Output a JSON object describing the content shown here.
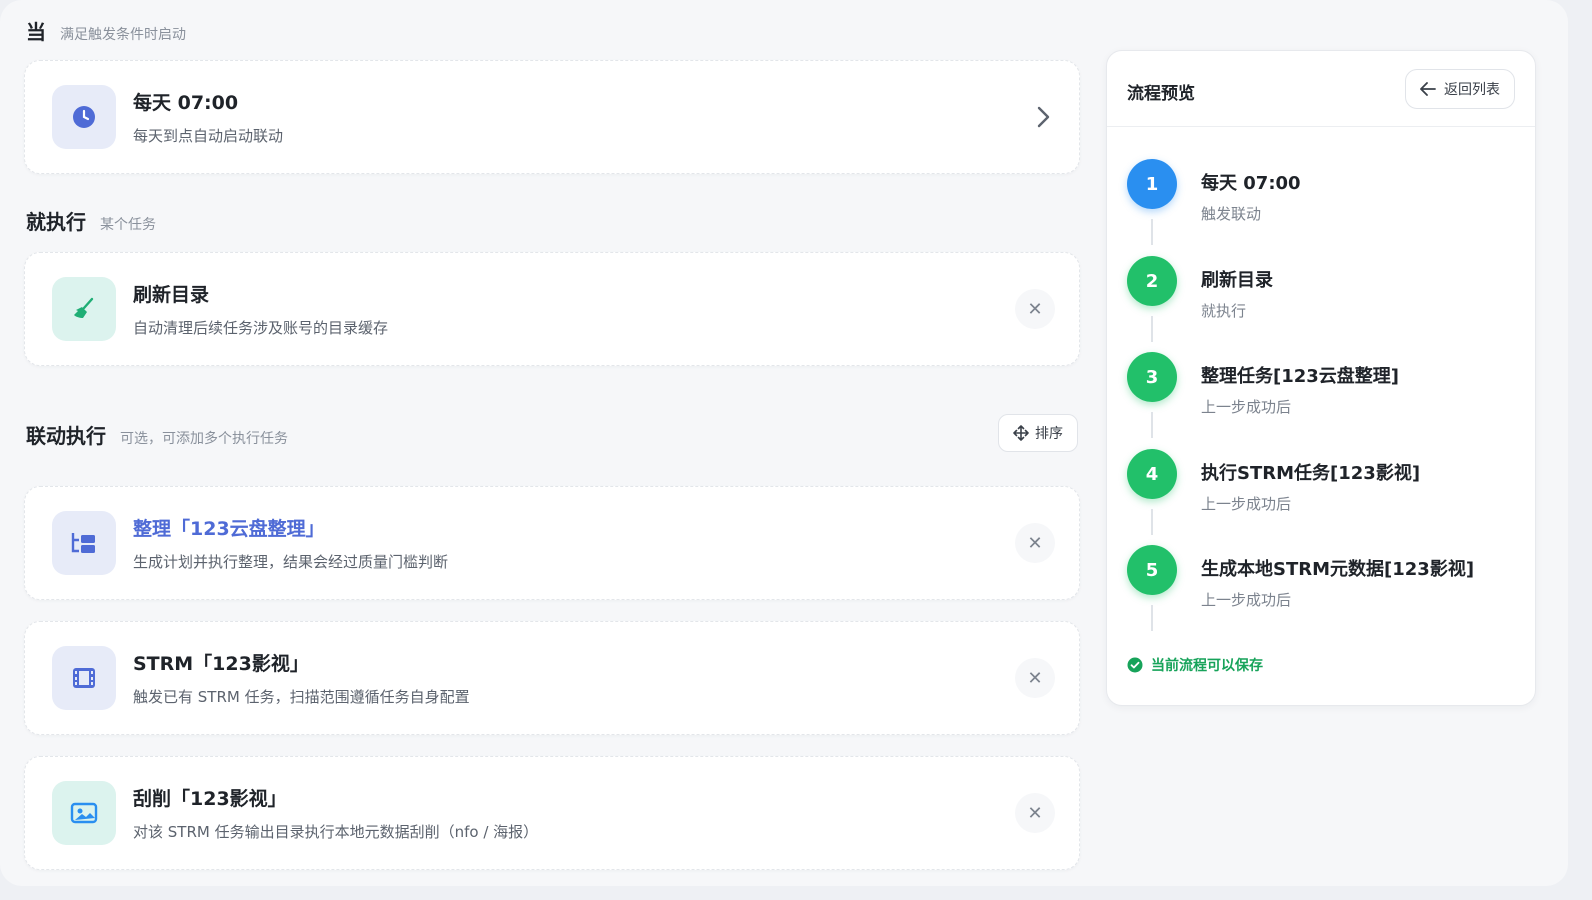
{
  "when": {
    "title": "当",
    "subtitle": "满足触发条件时启动"
  },
  "trigger": {
    "title": "每天 07:00",
    "desc": "每天到点自动启动联动",
    "icon": "clock-icon"
  },
  "then": {
    "title": "就执行",
    "subtitle": "某个任务"
  },
  "main_task": {
    "title": "刷新目录",
    "desc": "自动清理后续任务涉及账号的目录缓存",
    "icon": "broom-icon"
  },
  "linked": {
    "title": "联动执行",
    "subtitle": "可选，可添加多个执行任务",
    "sort_label": "排序"
  },
  "linked_tasks": [
    {
      "title": "整理「123云盘整理」",
      "desc": "生成计划并执行整理，结果会经过质量门槛判断",
      "icon": "folder-tree-icon"
    },
    {
      "title": "STRM「123影视」",
      "desc": "触发已有 STRM 任务，扫描范围遵循任务自身配置",
      "icon": "film-icon"
    },
    {
      "title": "刮削「123影视」",
      "desc": "对该 STRM 任务输出目录执行本地元数据刮削（nfo / 海报）",
      "icon": "image-icon"
    }
  ],
  "preview": {
    "title": "流程预览",
    "back_label": "返回列表",
    "steps": [
      {
        "num": "1",
        "title": "每天 07:00",
        "sub": "触发联动",
        "color": "#2a8ff0"
      },
      {
        "num": "2",
        "title": "刷新目录",
        "sub": "就执行",
        "color": "#22c06a"
      },
      {
        "num": "3",
        "title": "整理任务[123云盘整理]",
        "sub": "上一步成功后",
        "color": "#22c06a"
      },
      {
        "num": "4",
        "title": "执行STRM任务[123影视]",
        "sub": "上一步成功后",
        "color": "#22c06a"
      },
      {
        "num": "5",
        "title": "生成本地STRM元数据[123影视]",
        "sub": "上一步成功后",
        "color": "#22c06a"
      }
    ],
    "status": "当前流程可以保存"
  },
  "remove_glyph": "✕"
}
